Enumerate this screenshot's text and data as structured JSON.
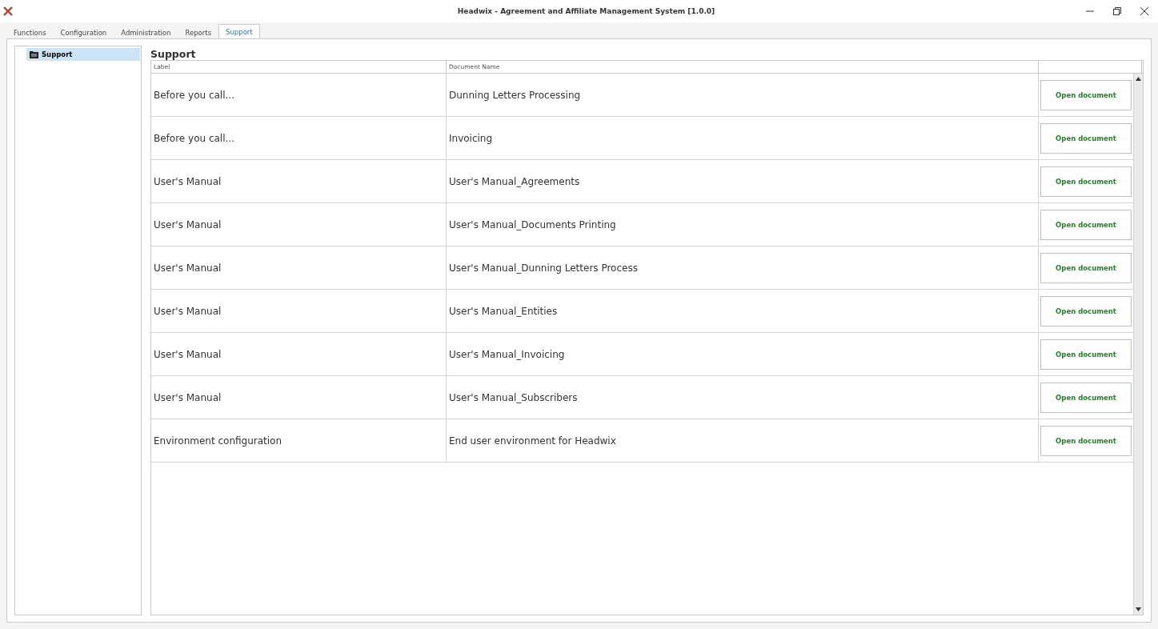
{
  "window": {
    "title": "Headwix - Agreement and Affiliate Management System [1.0.0]"
  },
  "tabs": [
    {
      "label": "Functions",
      "selected": false
    },
    {
      "label": "Configuration",
      "selected": false
    },
    {
      "label": "Administration",
      "selected": false
    },
    {
      "label": "Reports",
      "selected": false
    },
    {
      "label": "Support",
      "selected": true
    }
  ],
  "sidebar": {
    "items": [
      {
        "label": "Support",
        "selected": true
      }
    ]
  },
  "section_title": "Support",
  "table": {
    "columns": [
      "Label",
      "Document Name"
    ],
    "rows": [
      {
        "label": "Before you call...",
        "document": "Dunning Letters Processing",
        "action": "Open document"
      },
      {
        "label": "Before you call...",
        "document": "Invoicing",
        "action": "Open document"
      },
      {
        "label": "User's Manual",
        "document": "User's Manual_Agreements",
        "action": "Open document"
      },
      {
        "label": "User's Manual",
        "document": "User's Manual_Documents Printing",
        "action": "Open document"
      },
      {
        "label": "User's Manual",
        "document": "User's Manual_Dunning Letters Process",
        "action": "Open document"
      },
      {
        "label": "User's Manual",
        "document": "User's Manual_Entities",
        "action": "Open document"
      },
      {
        "label": "User's Manual",
        "document": "User's Manual_Invoicing",
        "action": "Open document"
      },
      {
        "label": "User's Manual",
        "document": "User's Manual_Subscribers",
        "action": "Open document"
      },
      {
        "label": "Environment configuration",
        "document": "End user environment for Headwix",
        "action": "Open document"
      }
    ]
  }
}
